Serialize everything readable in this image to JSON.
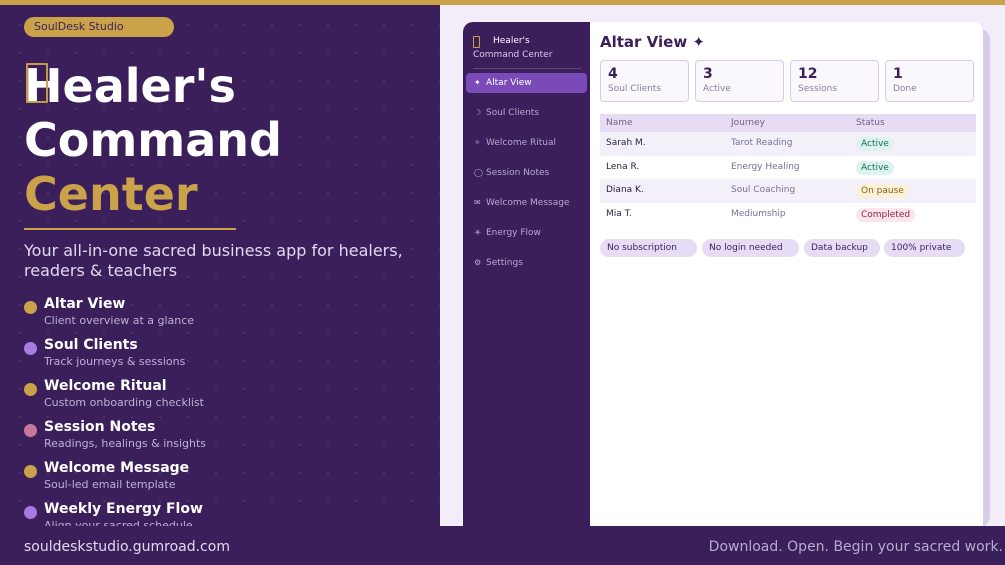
{
  "brand": {
    "name": "SoulDesk Studio"
  },
  "hero": {
    "title_line1": "Healer's",
    "title_line2": "Command",
    "title_line3": "Center",
    "subtitle": "Your all-in-one sacred business app for healers, readers & teachers"
  },
  "features": [
    {
      "title": "Altar View",
      "desc": "Client overview at a glance",
      "color": "#c9a24a"
    },
    {
      "title": "Soul Clients",
      "desc": "Track journeys & sessions",
      "color": "#a77be0"
    },
    {
      "title": "Welcome Ritual",
      "desc": "Custom onboarding checklist",
      "color": "#c9a24a"
    },
    {
      "title": "Session Notes",
      "desc": "Readings, healings & insights",
      "color": "#c9789a"
    },
    {
      "title": "Welcome Message",
      "desc": "Soul-led email template",
      "color": "#c9a24a"
    },
    {
      "title": "Weekly Energy Flow",
      "desc": "Align your sacred schedule",
      "color": "#a77be0"
    }
  ],
  "app": {
    "sidebar_title": "Healer's",
    "sidebar_subtitle": "Command Center",
    "nav": [
      {
        "label": "Altar View",
        "icon": "✦",
        "active": true
      },
      {
        "label": "Soul Clients",
        "icon": "☽",
        "active": false
      },
      {
        "label": "Welcome Ritual",
        "icon": "✧",
        "active": false
      },
      {
        "label": "Session Notes",
        "icon": "◯",
        "active": false
      },
      {
        "label": "Welcome Message",
        "icon": "✉",
        "active": false
      },
      {
        "label": "Energy Flow",
        "icon": "☀",
        "active": false
      },
      {
        "label": "Settings",
        "icon": "⚙",
        "active": false
      }
    ],
    "main_title": "Altar View ✦",
    "stats": [
      {
        "value": "4",
        "label": "Soul Clients"
      },
      {
        "value": "3",
        "label": "Active"
      },
      {
        "value": "12",
        "label": "Sessions"
      },
      {
        "value": "1",
        "label": "Done"
      }
    ],
    "table": {
      "headers": [
        "Name",
        "Journey",
        "Status"
      ],
      "rows": [
        {
          "name": "Sarah M.",
          "journey": "Tarot Reading",
          "status": "Active",
          "kind": "active"
        },
        {
          "name": "Lena R.",
          "journey": "Energy Healing",
          "status": "Active",
          "kind": "active"
        },
        {
          "name": "Diana K.",
          "journey": "Soul Coaching",
          "status": "On pause",
          "kind": "pause"
        },
        {
          "name": "Mia T.",
          "journey": "Mediumship",
          "status": "Completed",
          "kind": "done"
        }
      ]
    },
    "tags": [
      "No subscription",
      "No login needed",
      "Data backup",
      "100% private"
    ]
  },
  "footer": {
    "url": "souldeskstudio.gumroad.com",
    "tagline": "Download. Open. Begin your sacred work."
  },
  "colors": {
    "purple": "#3b1f5b",
    "gold": "#c9a24a",
    "accent": "#7a4bb8"
  }
}
